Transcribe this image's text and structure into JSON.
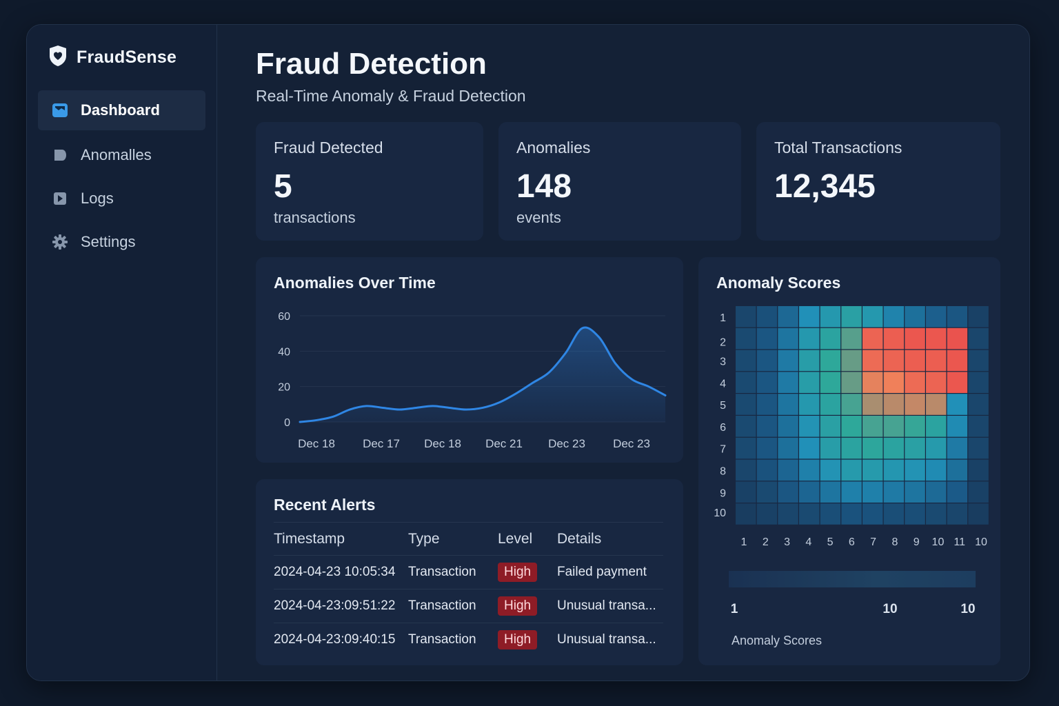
{
  "brand": {
    "name": "FraudSense",
    "logo_icon": "shield-heart-icon"
  },
  "sidebar": {
    "items": [
      {
        "label": "Dashboard",
        "icon": "dashboard-icon",
        "active": true
      },
      {
        "label": "Anomalles",
        "icon": "tag-icon",
        "active": false
      },
      {
        "label": "Logs",
        "icon": "play-icon",
        "active": false
      },
      {
        "label": "Settings",
        "icon": "gear-icon",
        "active": false
      }
    ]
  },
  "header": {
    "title": "Fraud Detection",
    "subtitle": "Real-Time Anomaly & Fraud Detection"
  },
  "stats": [
    {
      "label": "Fraud Detected",
      "value": "5",
      "unit": "transactions"
    },
    {
      "label": "Anomalies",
      "value": "148",
      "unit": "events"
    },
    {
      "label": "Total Transactions",
      "value": "12,345",
      "unit": ""
    }
  ],
  "colors": {
    "accent": "#2f86e4",
    "badge_high": "#8e1c26",
    "heat_low": "#1b3a5e",
    "heat_mid": "#2ea89a",
    "heat_high": "#e8424a"
  },
  "anomalies_chart": {
    "title": "Anomalies Over Time"
  },
  "heatmap_card": {
    "title": "Anomaly Scores",
    "scale_labels": [
      "1",
      "10",
      "10"
    ],
    "scale_title": "Anomaly Scores"
  },
  "alerts": {
    "title": "Recent Alerts",
    "columns": [
      "Timestamp",
      "Type",
      "Level",
      "Details"
    ],
    "rows": [
      {
        "timestamp": "2024-04-23 10:05:34",
        "type": "Transaction",
        "level": "High",
        "details": "Failed payment"
      },
      {
        "timestamp": "2024-04-23:09:51:22",
        "type": "Transaction",
        "level": "High",
        "details": "Unusual transa..."
      },
      {
        "timestamp": "2024-04-23:09:40:15",
        "type": "Transaction",
        "level": "High",
        "details": "Unusual transa..."
      }
    ]
  },
  "chart_data": [
    {
      "type": "area",
      "title": "Anomalies Over Time",
      "xlabel": "",
      "ylabel": "",
      "x_tick_labels": [
        "Dec 18",
        "Dec 17",
        "Dec 18",
        "Dec 21",
        "Dec 23",
        "Dec 23"
      ],
      "y_ticks": [
        0,
        20,
        40,
        60
      ],
      "ylim": [
        0,
        60
      ],
      "grid": true,
      "series": [
        {
          "x": [
            0,
            0.25,
            0.5,
            0.75,
            1.0,
            1.25,
            1.5,
            1.75,
            2.0,
            2.25,
            2.5,
            2.75,
            3.0,
            3.25,
            3.5,
            3.75,
            4.0,
            4.25,
            4.5,
            4.75,
            5.0,
            5.25,
            5.5
          ],
          "values": [
            0,
            1,
            3,
            7,
            9,
            8,
            7,
            8,
            9,
            8,
            7,
            8,
            11,
            16,
            22,
            28,
            39,
            53,
            48,
            33,
            24,
            20,
            15
          ]
        }
      ]
    },
    {
      "type": "heatmap",
      "title": "Anomaly Scores",
      "x_tick_labels": [
        "1",
        "2",
        "3",
        "4",
        "5",
        "6",
        "7",
        "8",
        "9",
        "10",
        "11",
        "10"
      ],
      "y_tick_labels": [
        "1",
        "2",
        "3",
        "4",
        "5",
        "6",
        "7",
        "8",
        "9",
        "10"
      ],
      "values": [
        [
          10,
          15,
          25,
          40,
          45,
          50,
          45,
          35,
          28,
          22,
          18,
          8
        ],
        [
          12,
          18,
          30,
          45,
          52,
          60,
          90,
          92,
          94,
          94,
          95,
          10
        ],
        [
          12,
          18,
          32,
          48,
          55,
          62,
          88,
          90,
          92,
          92,
          94,
          10
        ],
        [
          12,
          18,
          32,
          48,
          55,
          62,
          80,
          82,
          88,
          90,
          94,
          10
        ],
        [
          12,
          18,
          30,
          45,
          52,
          58,
          70,
          72,
          74,
          72,
          40,
          10
        ],
        [
          12,
          18,
          28,
          42,
          50,
          55,
          58,
          58,
          56,
          52,
          38,
          10
        ],
        [
          12,
          18,
          28,
          40,
          48,
          52,
          54,
          52,
          50,
          46,
          32,
          10
        ],
        [
          10,
          16,
          24,
          34,
          42,
          46,
          46,
          44,
          42,
          38,
          28,
          8
        ],
        [
          8,
          12,
          18,
          24,
          30,
          34,
          34,
          32,
          30,
          26,
          20,
          8
        ],
        [
          6,
          8,
          10,
          12,
          14,
          16,
          16,
          14,
          14,
          12,
          10,
          6
        ]
      ],
      "colorbar_labels": [
        "1",
        "10",
        "10"
      ],
      "colorbar_title": "Anomaly Scores"
    }
  ]
}
